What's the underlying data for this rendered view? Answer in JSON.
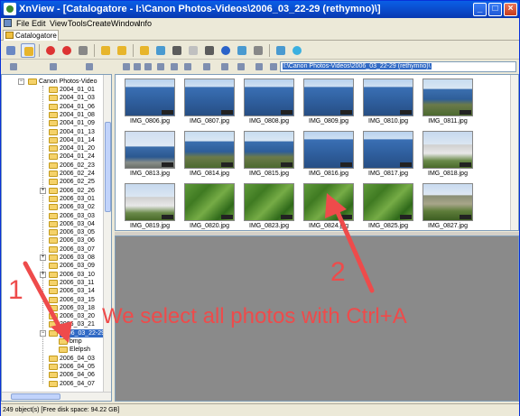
{
  "window": {
    "title": "XnView - [Catalogatore - I:\\Canon Photos-Videos\\2006_03_22-29 (rethymno)\\]",
    "controls": [
      "_",
      "□",
      "×"
    ]
  },
  "menu": [
    "File",
    "Edit",
    "View",
    "Tools",
    "Create",
    "Window",
    "Info"
  ],
  "tab": {
    "label": "Catalogatore"
  },
  "address": {
    "value": "I:\\Canon Photos-Videos\\2006_03_22-29 (rethymno)\\"
  },
  "tree": {
    "root": "Canon Photos-Video",
    "folders": [
      "2004_01_01",
      "2004_01_03",
      "2004_01_06",
      "2004_01_08",
      "2004_01_09",
      "2004_01_13",
      "2004_01_14",
      "2004_01_20",
      "2004_01_24",
      "2006_02_23",
      "2006_02_24",
      "2006_02_25",
      "2006_02_26",
      "2006_03_01",
      "2006_03_02",
      "2006_03_03",
      "2006_03_04",
      "2006_03_05",
      "2006_03_06",
      "2006_03_07",
      "2006_03_08",
      "2006_03_09",
      "2006_03_10",
      "2006_03_11",
      "2006_03_14",
      "2006_03_15",
      "2006_03_18",
      "2006_03_20",
      "2006_03_21",
      "2006_03_22-29",
      "bmp",
      "Elelpsh",
      "2006_04_03",
      "2006_04_05",
      "2006_04_06",
      "2006_04_07"
    ],
    "selected": "2006_03_22-29"
  },
  "thumbnails": [
    {
      "name": "IMG_0806.jpg",
      "scene": "sea"
    },
    {
      "name": "IMG_0807.jpg",
      "scene": "sea"
    },
    {
      "name": "IMG_0808.jpg",
      "scene": "sea"
    },
    {
      "name": "IMG_0809.jpg",
      "scene": "sea"
    },
    {
      "name": "IMG_0810.jpg",
      "scene": "sea"
    },
    {
      "name": "IMG_0811.jpg",
      "scene": "coast"
    },
    {
      "name": "IMG_0813.jpg",
      "scene": "structure"
    },
    {
      "name": "IMG_0814.jpg",
      "scene": "coast"
    },
    {
      "name": "IMG_0815.jpg",
      "scene": "coast"
    },
    {
      "name": "IMG_0816.jpg",
      "scene": "sea"
    },
    {
      "name": "IMG_0817.jpg",
      "scene": "sea"
    },
    {
      "name": "IMG_0818.jpg",
      "scene": "building"
    },
    {
      "name": "IMG_0819.jpg",
      "scene": "building"
    },
    {
      "name": "IMG_0820.jpg",
      "scene": "grass"
    },
    {
      "name": "IMG_0823.jpg",
      "scene": "grass"
    },
    {
      "name": "IMG_0824.jpg",
      "scene": "grass"
    },
    {
      "name": "IMG_0825.jpg",
      "scene": "grass"
    },
    {
      "name": "IMG_0827.jpg",
      "scene": "wall"
    }
  ],
  "status": "249 object(s) [Free disk space: 94.22 GB]",
  "annotations": {
    "label1": "1",
    "label2": "2",
    "message": "We select all photos with Ctrl+A"
  },
  "colors": {
    "annotation": "#ee4b4b",
    "selection": "#316ac5",
    "titlebar": "#0a48c8"
  }
}
